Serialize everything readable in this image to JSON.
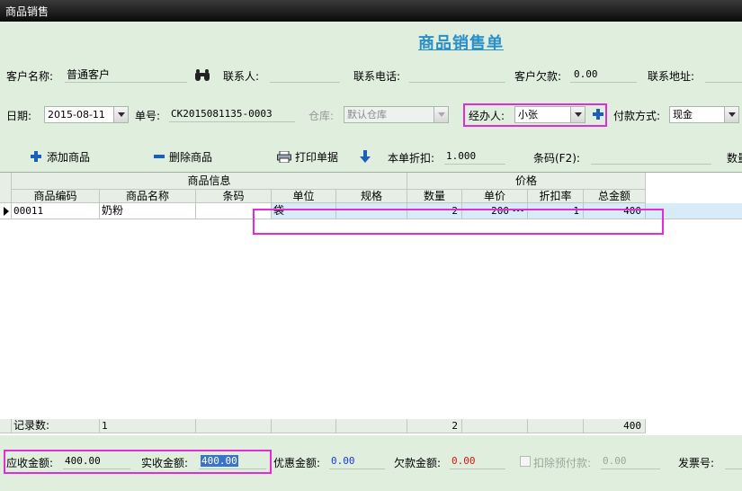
{
  "window": {
    "title": "商品销售"
  },
  "page_title": "商品销售单",
  "customer": {
    "name_label": "客户名称:",
    "name_value": "普通客户",
    "contact_label": "联系人:",
    "contact_value": "",
    "phone_label": "联系电话:",
    "phone_value": "",
    "debt_label": "客户欠款:",
    "debt_value": "0.00",
    "address_label": "联系地址:",
    "address_value": ""
  },
  "order": {
    "date_label": "日期:",
    "date_value": "2015-08-11",
    "number_label": "单号:",
    "number_value": "CK2015081135-0003",
    "warehouse_label": "仓库:",
    "warehouse_value": "默认仓库",
    "handler_label": "经办人:",
    "handler_value": "小张",
    "payment_label": "付款方式:",
    "payment_value": "现金"
  },
  "toolbar": {
    "add_label": "添加商品",
    "delete_label": "删除商品",
    "print_label": "打印单据",
    "discount_label": "本单折扣:",
    "discount_value": "1.000",
    "barcode_label": "条码(F2):",
    "barcode_value": "",
    "qty_label": "数量"
  },
  "grid": {
    "group_headers": [
      "商品信息",
      "价格"
    ],
    "columns": [
      "商品编码",
      "商品名称",
      "条码",
      "单位",
      "规格",
      "数量",
      "单价",
      "折扣率",
      "总金额"
    ],
    "rows": [
      {
        "code": "00011",
        "name": "奶粉",
        "barcode": "",
        "unit": "袋",
        "spec": "",
        "qty": "2",
        "price": "200",
        "price_btn": "···",
        "discount": "1",
        "total": "400"
      }
    ],
    "summary": {
      "label": "记录数:",
      "count": "1",
      "qty": "2",
      "total": "400"
    }
  },
  "footer": {
    "receivable_label": "应收金额:",
    "receivable_value": "400.00",
    "received_label": "实收金额:",
    "received_value": "400.00",
    "discount_label": "优惠金额:",
    "discount_value": "0.00",
    "debt_label": "欠款金额:",
    "debt_value": "0.00",
    "prepay_label": "扣除预付款:",
    "prepay_value": "0.00",
    "invoice_label": "发票号:",
    "invoice_value": ""
  },
  "colors": {
    "background": "#dfeedd",
    "title": "#2a8fc9",
    "highlight": "#e52bd8",
    "icon": "#1c5fb8"
  }
}
